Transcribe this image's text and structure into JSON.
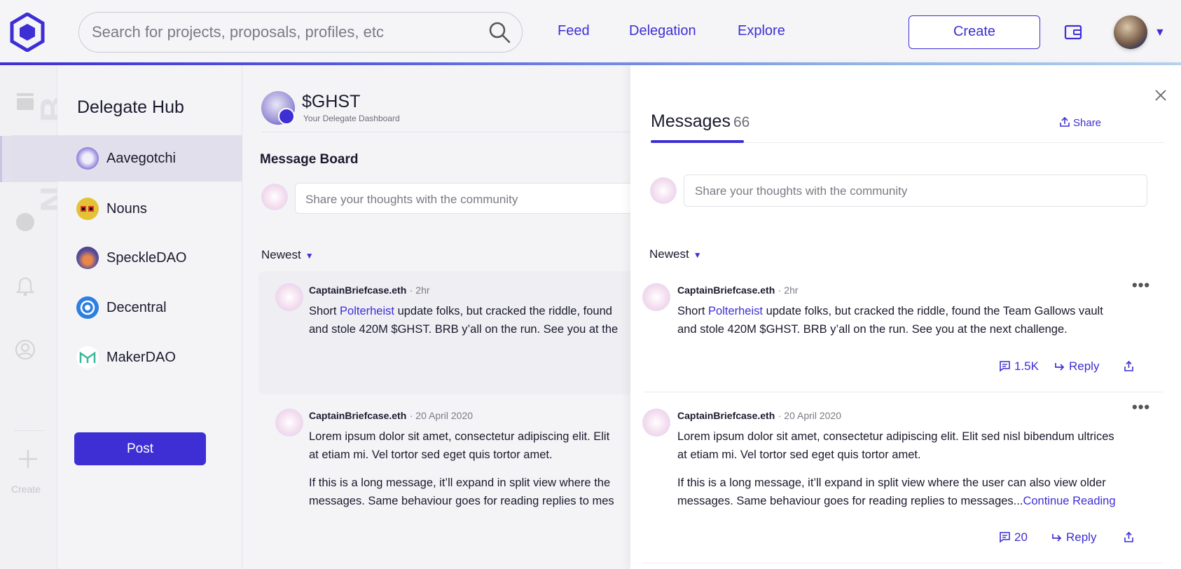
{
  "header": {
    "search_placeholder": "Search for projects, proposals, profiles, etc",
    "nav": [
      "Feed",
      "Delegation",
      "Explore"
    ],
    "create_label": "Create"
  },
  "rail": {
    "watermark": "NAV B",
    "create_label": "Create"
  },
  "hub": {
    "title": "Delegate Hub",
    "items": [
      {
        "label": "Aavegotchi",
        "active": true
      },
      {
        "label": "Nouns",
        "active": false
      },
      {
        "label": "SpeckleDAO",
        "active": false
      },
      {
        "label": "Decentral",
        "active": false
      },
      {
        "label": "MakerDAO",
        "active": false
      }
    ],
    "post_label": "Post"
  },
  "main": {
    "title": "$GHST",
    "subtitle": "Your Delegate Dashboard",
    "board_title": "Message Board",
    "input_placeholder": "Share your thoughts with the community",
    "sort_label": "Newest",
    "posts": [
      {
        "author": "CaptainBriefcase.eth",
        "time": "· 2hr",
        "text_before": "Short ",
        "link": "Polterheist",
        "text_after": " update folks, but cracked the riddle, found",
        "line2": "and stole 420M $GHST. BRB y’all on the run. See you at the"
      },
      {
        "author": "CaptainBriefcase.eth",
        "time": "· 20 April 2020",
        "para1_line1": "Lorem ipsum dolor sit amet, consectetur adipiscing elit. Elit",
        "para1_line2": "at etiam mi. Vel tortor sed eget quis tortor amet.",
        "para2_line1": "If this is a long message, it’ll expand in split view where the",
        "para2_line2": "messages. Same behaviour goes for reading replies to mes"
      }
    ]
  },
  "panel": {
    "title": "Messages",
    "count": "66",
    "share_label": "Share",
    "input_placeholder": "Share your thoughts with the community",
    "sort_label": "Newest",
    "posts": [
      {
        "author": "CaptainBriefcase.eth",
        "time": "· 2hr",
        "text_before": "Short ",
        "link": "Polterheist",
        "text_after": " update folks, but cracked the riddle, found the Team Gallows vault",
        "line2": "and stole 420M $GHST. BRB y’all on the run. See you at the next challenge.",
        "comments": "1.5K",
        "reply_label": "Reply"
      },
      {
        "author": "CaptainBriefcase.eth",
        "time": "· 20 April 2020",
        "para1_line1": "Lorem ipsum dolor sit amet, consectetur adipiscing elit. Elit sed nisl bibendum ultrices",
        "para1_line2": "at etiam mi. Vel tortor sed eget quis tortor amet.",
        "para2_line1": "If this is a long message, it’ll expand in split view where the user can also view older",
        "para2_line2": "messages. Same behaviour goes for reading replies to messages...",
        "continue_label": "Continue Reading",
        "comments": "20",
        "reply_label": "Reply"
      }
    ]
  },
  "colors": {
    "accent": "#3d2fd3",
    "panel_bg": "#ffffff",
    "page_bg": "#f4f4f7"
  }
}
